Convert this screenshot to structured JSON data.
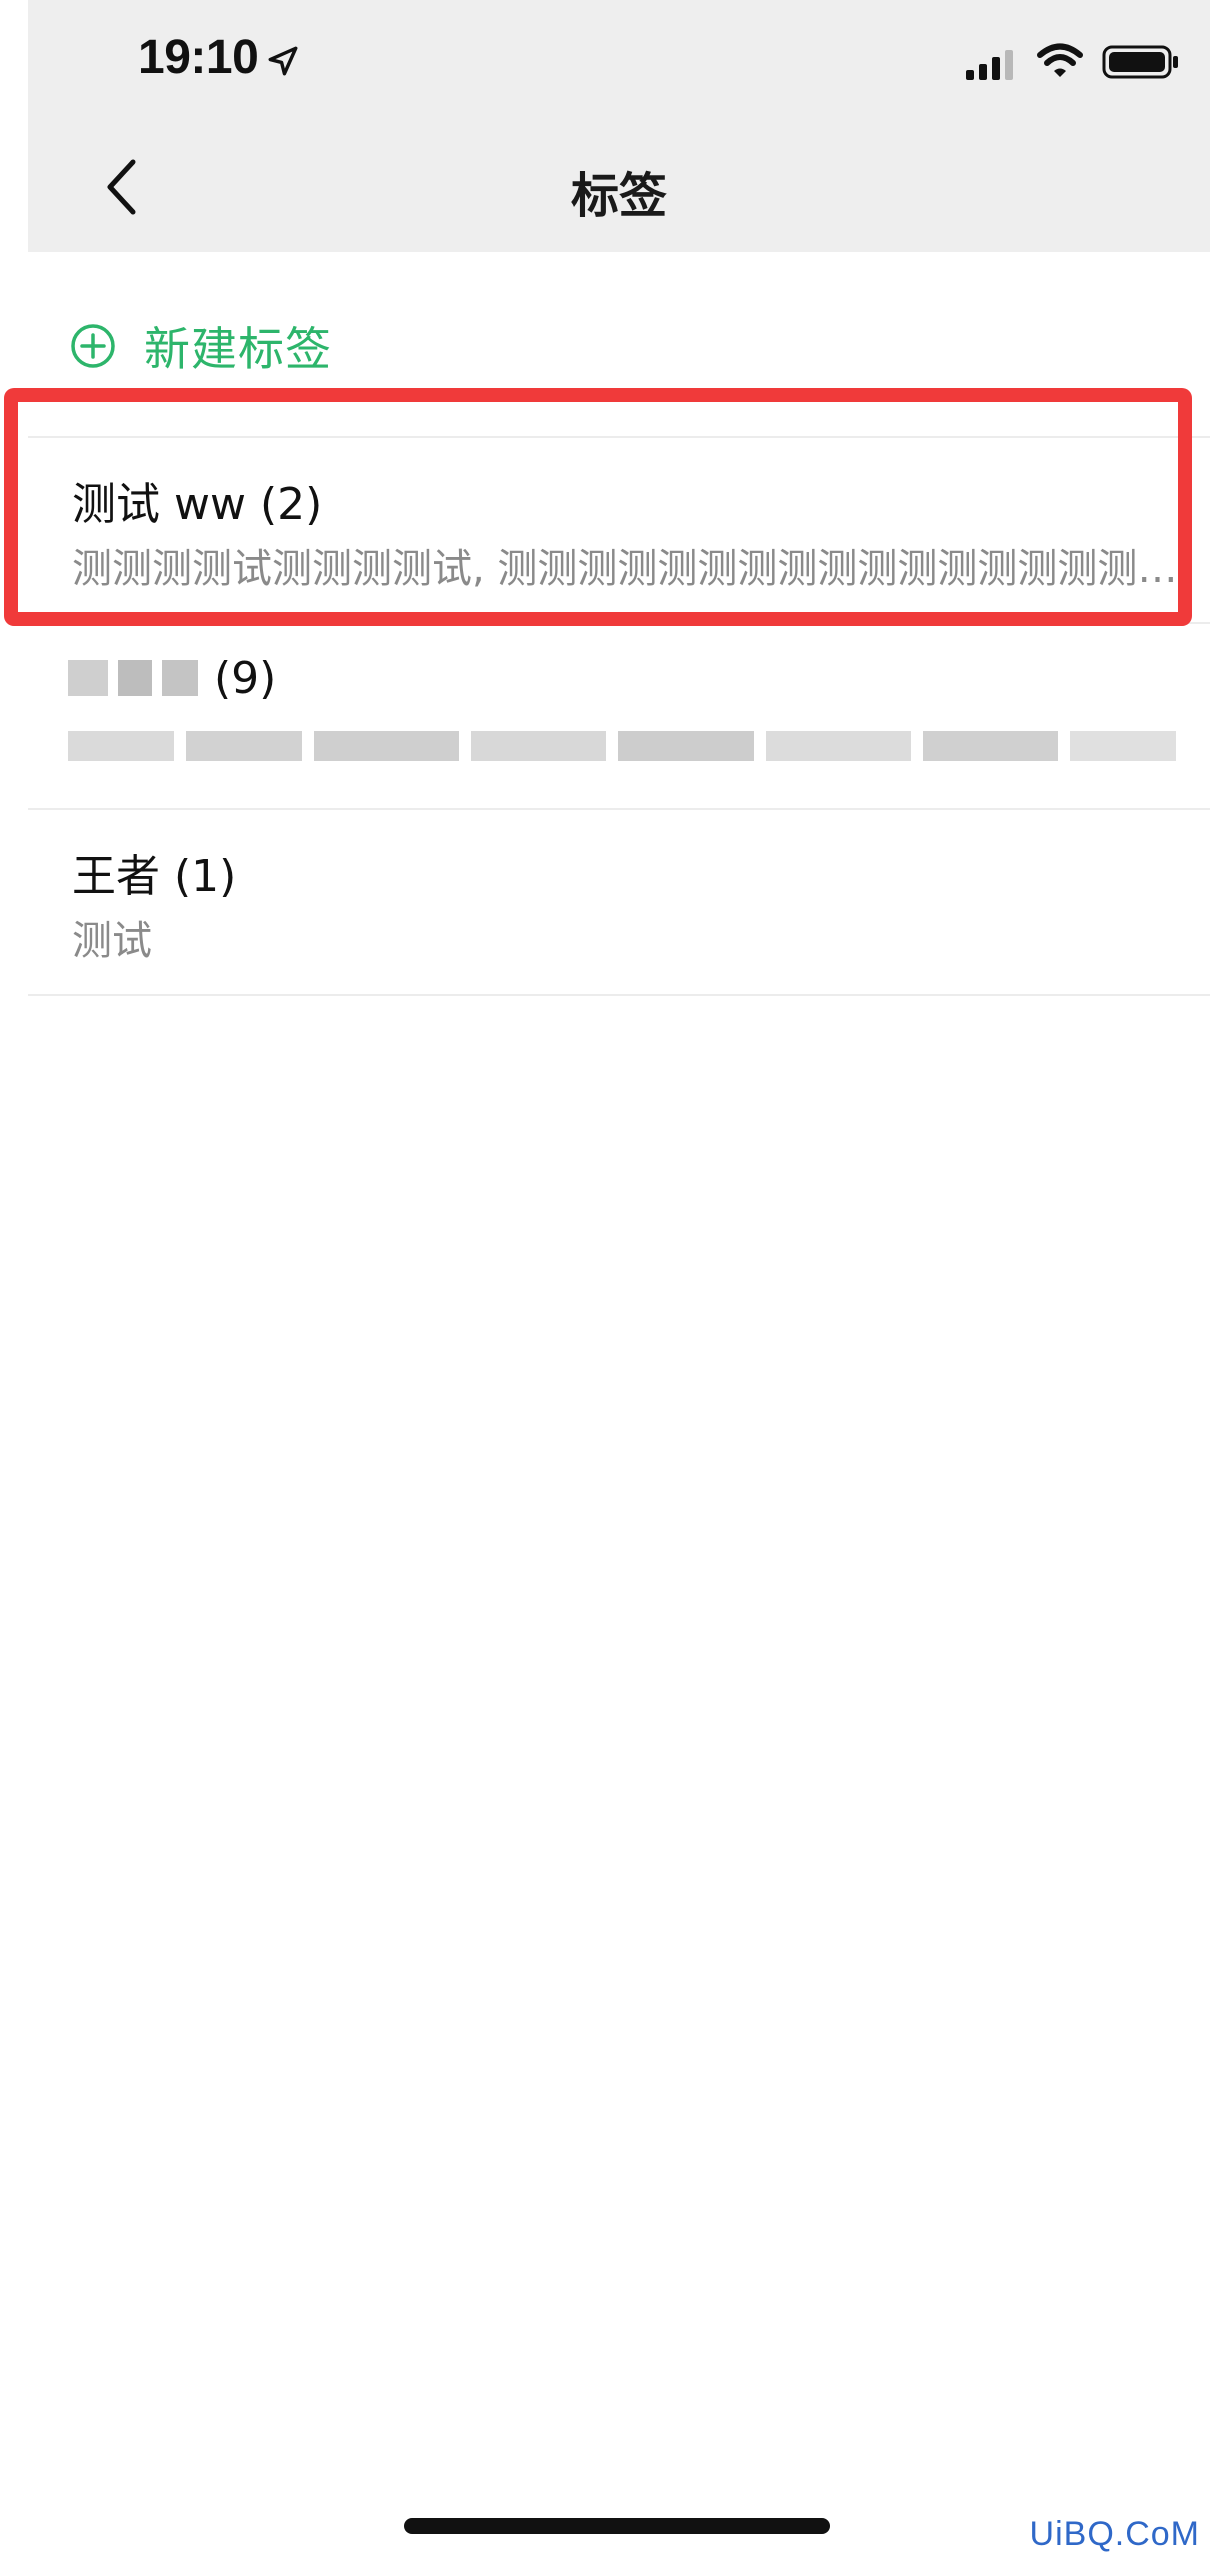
{
  "status_bar": {
    "time": "19:10",
    "location_icon": "location-arrow-icon",
    "cell_icon": "cellular-signal-icon",
    "wifi_icon": "wifi-icon",
    "battery_icon": "battery-icon"
  },
  "nav": {
    "title": "标签",
    "back_icon": "chevron-left-icon"
  },
  "new_tag": {
    "label": "新建标签",
    "icon": "plus-circle-icon",
    "color": "#2db56b"
  },
  "tags": [
    {
      "name": "测试 ww (2)",
      "members": "测测测测试测测测测试, 测测测测测测测测测测测测测测测测测测测测测测测测测测测测"
    },
    {
      "name": "(9)",
      "members": "",
      "pixelated": true
    },
    {
      "name": "王者 (1)",
      "members": "测试"
    }
  ],
  "highlight_color": "#f03a3a",
  "watermark": "UiBQ.CoM"
}
